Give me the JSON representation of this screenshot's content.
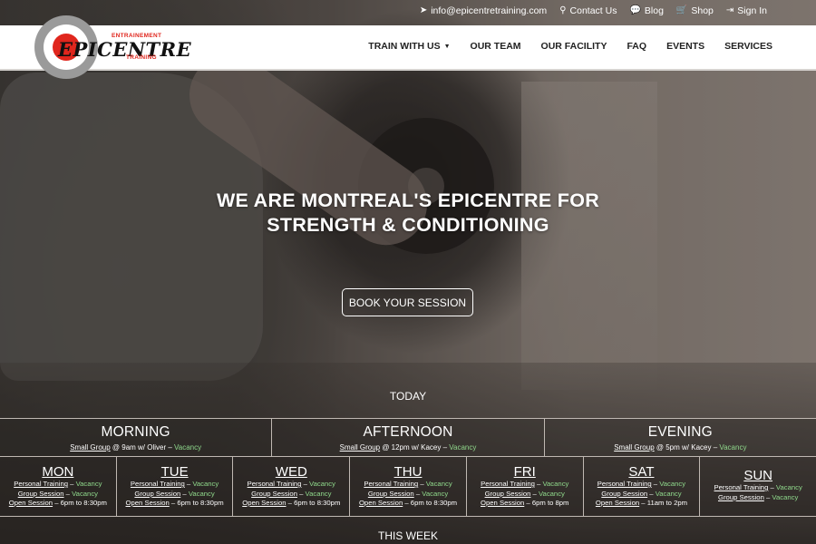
{
  "topbar": {
    "email": "info@epicentretraining.com",
    "contact": "Contact Us",
    "blog": "Blog",
    "shop": "Shop",
    "signin": "Sign In"
  },
  "logo": {
    "word": "EPICENTRE",
    "top": "ENTRAINEMENT",
    "bottom": "TRAINING"
  },
  "menu": {
    "train": "TRAIN WITH US",
    "team": "OUR TEAM",
    "facility": "OUR FACILITY",
    "faq": "FAQ",
    "events": "EVENTS",
    "services": "SERVICES"
  },
  "hero": {
    "line1": "WE ARE MONTREAL'S EPICENTRE FOR",
    "line2": "STRENGTH & CONDITIONING",
    "button": "BOOK YOUR SESSION"
  },
  "schedule": {
    "today_label": "TODAY",
    "week_label": "THIS WEEK",
    "today": [
      {
        "title": "MORNING",
        "link": "Small Group",
        "detail": " @ 9am w/ Oliver – ",
        "status": "Vacancy"
      },
      {
        "title": "AFTERNOON",
        "link": "Small Group",
        "detail": " @ 12pm w/ Kacey – ",
        "status": "Vacancy"
      },
      {
        "title": "EVENING",
        "link": "Small Group",
        "detail": " @ 5pm w/ Kacey – ",
        "status": "Vacancy"
      }
    ],
    "week": [
      {
        "day": "MON",
        "pt": "Personal Training",
        "pt_status": "Vacancy",
        "gs": "Group Session",
        "gs_status": "Vacancy",
        "os": "Open Session",
        "os_time": "6pm to 8:30pm"
      },
      {
        "day": "TUE",
        "pt": "Personal Training",
        "pt_status": "Vacancy",
        "gs": "Group Session",
        "gs_status": "Vacancy",
        "os": "Open Session",
        "os_time": "6pm to 8:30pm"
      },
      {
        "day": "WED",
        "pt": "Personal Training",
        "pt_status": "Vacancy",
        "gs": "Group Session",
        "gs_status": "Vacancy",
        "os": "Open Session",
        "os_time": "6pm to 8:30pm"
      },
      {
        "day": "THU",
        "pt": "Personal Training",
        "pt_status": "Vacancy",
        "gs": "Group Session",
        "gs_status": "Vacancy",
        "os": "Open Session",
        "os_time": "6pm to 8:30pm"
      },
      {
        "day": "FRI",
        "pt": "Personal Training",
        "pt_status": "Vacancy",
        "gs": "Group Session",
        "gs_status": "Vacancy",
        "os": "Open Session",
        "os_time": "6pm to 8pm"
      },
      {
        "day": "SAT",
        "pt": "Personal Training",
        "pt_status": "Vacancy",
        "gs": "Group Session",
        "gs_status": "Vacancy",
        "os": "Open Session",
        "os_time": "11am to 2pm"
      },
      {
        "day": "SUN",
        "pt": "Personal Training",
        "pt_status": "Vacancy",
        "gs": "Group Session",
        "gs_status": "Vacancy"
      }
    ],
    "dash": " – "
  },
  "colors": {
    "accent_red": "#e0261d",
    "vacancy_green": "#8fd88b"
  }
}
